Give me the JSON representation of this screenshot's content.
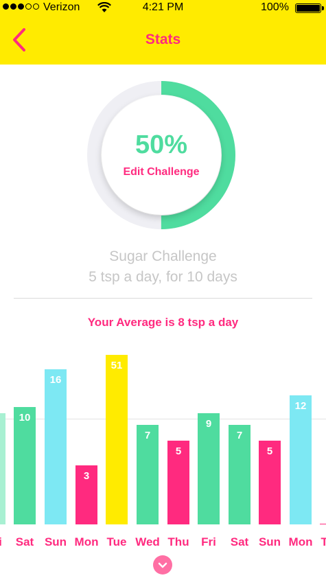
{
  "status_bar": {
    "carrier": "Verizon",
    "time": "4:21 PM",
    "battery": "100%"
  },
  "nav": {
    "title": "Stats"
  },
  "progress": {
    "percent_label": "50%",
    "value": 0.5,
    "edit_label": "Edit Challenge"
  },
  "challenge": {
    "name": "Sugar Challenge",
    "description": "5 tsp a day, for 10 days"
  },
  "average_label": "Your Average is 8 tsp a day",
  "colors": {
    "yellow": "#ffeb00",
    "pink": "#ff2a7f",
    "green": "#4fdc9f",
    "cyan": "#7de8f3",
    "light_green": "#a8f0d2",
    "track": "#efeff4"
  },
  "chart_data": {
    "type": "bar",
    "categories": [
      "Fri",
      "Sat",
      "Sun",
      "Mon",
      "Tue",
      "Wed",
      "Thu",
      "Fri",
      "Sat",
      "Sun",
      "Mon",
      "Tue"
    ],
    "values": [
      null,
      10,
      16,
      3,
      51,
      7,
      5,
      9,
      7,
      5,
      12,
      null
    ],
    "value_labels": [
      "",
      "10",
      "16",
      "3",
      "51",
      "7",
      "5",
      "9",
      "7",
      "5",
      "12",
      ""
    ],
    "colors": [
      "light_green",
      "green",
      "cyan",
      "pink",
      "yellow",
      "green",
      "pink",
      "green",
      "green",
      "pink",
      "cyan",
      "pink"
    ],
    "reference_line": 8
  }
}
